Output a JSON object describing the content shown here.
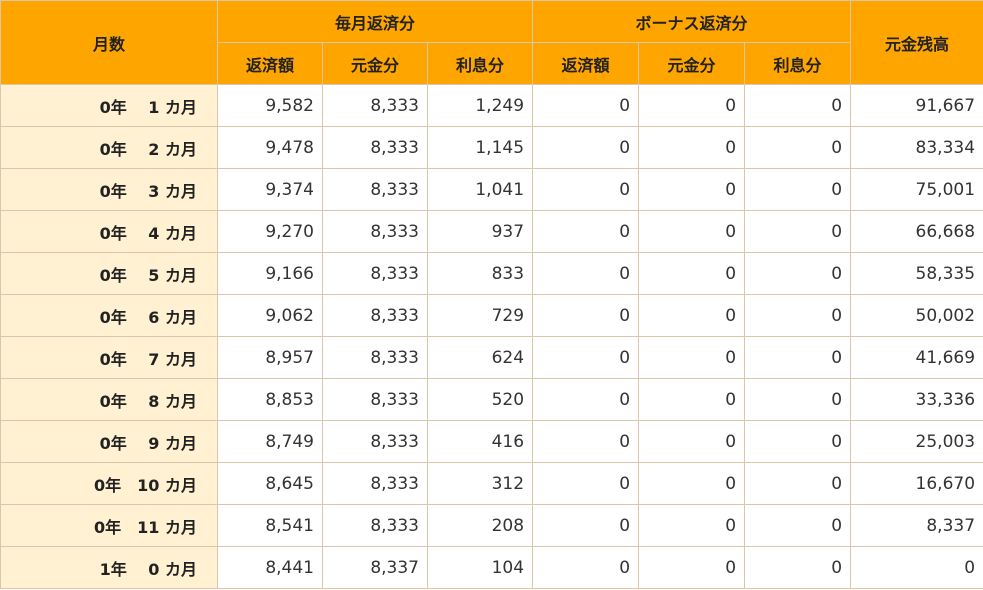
{
  "header": {
    "month_count": "月数",
    "monthly_group": "毎月返済分",
    "bonus_group": "ボーナス返済分",
    "principal_balance": "元金残高",
    "sub_columns": [
      "返済額",
      "元金分",
      "利息分",
      "返済額",
      "元金分",
      "利息分"
    ]
  },
  "rows": [
    {
      "period": "0年　 1 カ月",
      "values": [
        "9,582",
        "8,333",
        "1,249",
        "0",
        "0",
        "0",
        "91,667"
      ]
    },
    {
      "period": "0年　 2 カ月",
      "values": [
        "9,478",
        "8,333",
        "1,145",
        "0",
        "0",
        "0",
        "83,334"
      ]
    },
    {
      "period": "0年　 3 カ月",
      "values": [
        "9,374",
        "8,333",
        "1,041",
        "0",
        "0",
        "0",
        "75,001"
      ]
    },
    {
      "period": "0年　 4 カ月",
      "values": [
        "9,270",
        "8,333",
        "937",
        "0",
        "0",
        "0",
        "66,668"
      ]
    },
    {
      "period": "0年　 5 カ月",
      "values": [
        "9,166",
        "8,333",
        "833",
        "0",
        "0",
        "0",
        "58,335"
      ]
    },
    {
      "period": "0年　 6 カ月",
      "values": [
        "9,062",
        "8,333",
        "729",
        "0",
        "0",
        "0",
        "50,002"
      ]
    },
    {
      "period": "0年　 7 カ月",
      "values": [
        "8,957",
        "8,333",
        "624",
        "0",
        "0",
        "0",
        "41,669"
      ]
    },
    {
      "period": "0年　 8 カ月",
      "values": [
        "8,853",
        "8,333",
        "520",
        "0",
        "0",
        "0",
        "33,336"
      ]
    },
    {
      "period": "0年　 9 カ月",
      "values": [
        "8,749",
        "8,333",
        "416",
        "0",
        "0",
        "0",
        "25,003"
      ]
    },
    {
      "period": "0年　10 カ月",
      "values": [
        "8,645",
        "8,333",
        "312",
        "0",
        "0",
        "0",
        "16,670"
      ]
    },
    {
      "period": "0年　11 カ月",
      "values": [
        "8,541",
        "8,333",
        "208",
        "0",
        "0",
        "0",
        "8,337"
      ]
    },
    {
      "period": "1年　 0 カ月",
      "values": [
        "8,441",
        "8,337",
        "104",
        "0",
        "0",
        "0",
        "0"
      ]
    }
  ],
  "colors": {
    "header_bg": "#ffa500",
    "period_bg": "#fff1d2",
    "border": "#d8c7a8"
  }
}
